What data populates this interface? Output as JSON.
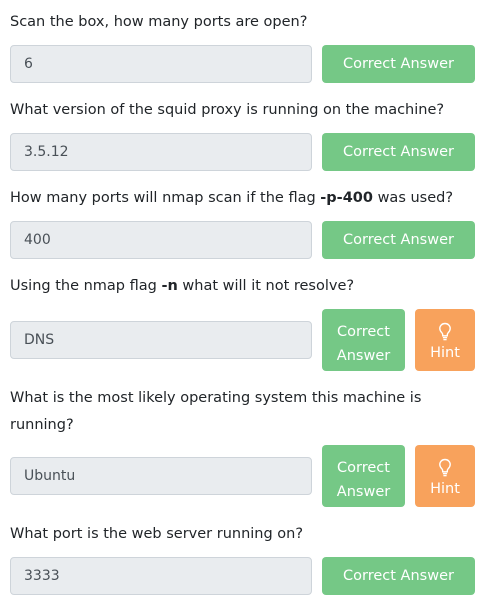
{
  "questions": [
    {
      "text_parts": [
        "Scan the box, how many ports are open?"
      ],
      "answer": "6",
      "button_label": "Correct Answer"
    },
    {
      "text_parts": [
        "What version of the squid proxy is running on the machine?"
      ],
      "answer": "3.5.12",
      "button_label": "Correct Answer"
    },
    {
      "text_parts": [
        "How many ports will nmap scan if the flag ",
        "-p-400",
        " was used?"
      ],
      "answer": "400",
      "button_label": "Correct Answer"
    },
    {
      "text_parts": [
        "Using the nmap flag ",
        "-n",
        " what will it not resolve?"
      ],
      "answer": "DNS",
      "button_label_line1": "Correct",
      "button_label_line2": "Answer",
      "hint_label": "Hint",
      "hint_icon": "lightbulb-icon"
    },
    {
      "text_parts": [
        "What is the most likely operating system this machine is running?"
      ],
      "answer": "Ubuntu",
      "button_label_line1": "Correct",
      "button_label_line2": "Answer",
      "hint_label": "Hint",
      "hint_icon": "lightbulb-icon"
    },
    {
      "text_parts": [
        "What port is the web server running on?"
      ],
      "answer": "3333",
      "button_label": "Correct Answer"
    }
  ],
  "colors": {
    "correct": "#75c886",
    "hint": "#f8a25c",
    "answer_bg": "#e9ecef"
  }
}
